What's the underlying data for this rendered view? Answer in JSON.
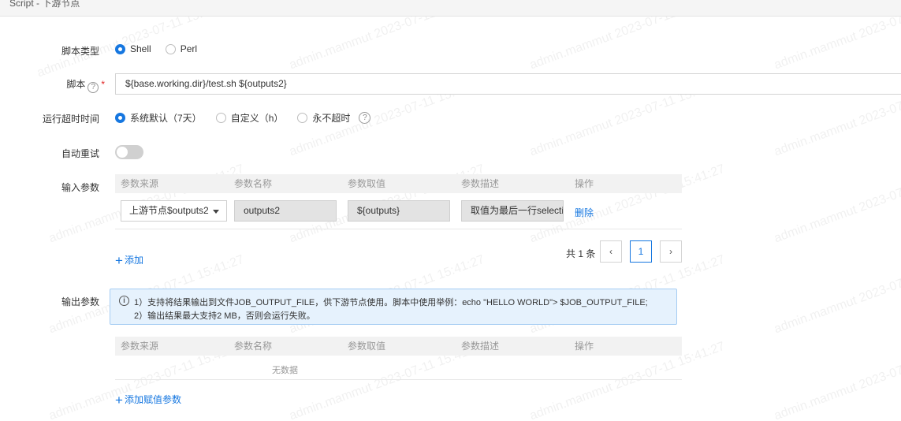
{
  "header": {
    "title": "Script - 下游节点"
  },
  "form": {
    "script_type": {
      "label": "脚本类型",
      "options": [
        {
          "label": "Shell",
          "checked": true
        },
        {
          "label": "Perl",
          "checked": false
        }
      ]
    },
    "script": {
      "label": "脚本",
      "help_icon": "question-icon",
      "required_mark": "*",
      "value": "${base.working.dir}/test.sh ${outputs2}"
    },
    "timeout": {
      "label": "运行超时时间",
      "options": [
        {
          "label": "系统默认（7天）",
          "checked": true
        },
        {
          "label": "自定义（h）",
          "checked": false
        },
        {
          "label": "永不超时",
          "checked": false
        }
      ],
      "help_icon": "question-icon"
    },
    "auto_retry": {
      "label": "自动重试",
      "enabled": false
    },
    "input_params": {
      "label": "输入参数",
      "columns": [
        "参数来源",
        "参数名称",
        "参数取值",
        "参数描述",
        "操作"
      ],
      "rows": [
        {
          "source": "上游节点$outputs2",
          "name": "outputs2",
          "value": "${outputs}",
          "desc": "取值为最后一行selecti",
          "action": "删除"
        }
      ],
      "add_label": "添加",
      "pagination": {
        "total_text": "共 1 条",
        "prev": "‹",
        "page": "1",
        "next": "›"
      }
    },
    "output_params": {
      "label": "输出参数",
      "info_lines": [
        "1）支持将结果输出到文件JOB_OUTPUT_FILE，供下游节点使用。脚本中使用举例：echo \"HELLO WORLD\"> $JOB_OUTPUT_FILE;",
        "2）输出结果最大支持2 MB，否则会运行失败。"
      ],
      "info_icon": "info-icon",
      "columns": [
        "参数来源",
        "参数名称",
        "参数取值",
        "参数描述",
        "操作"
      ],
      "empty_text": "无数据",
      "add_label": "添加赋值参数"
    }
  },
  "watermark": "admin.mammut 2023-07-11 15:41:27",
  "colors": {
    "accent": "#1677e0",
    "info_bg": "#e6f2fd",
    "info_border": "#a6cdf3"
  }
}
